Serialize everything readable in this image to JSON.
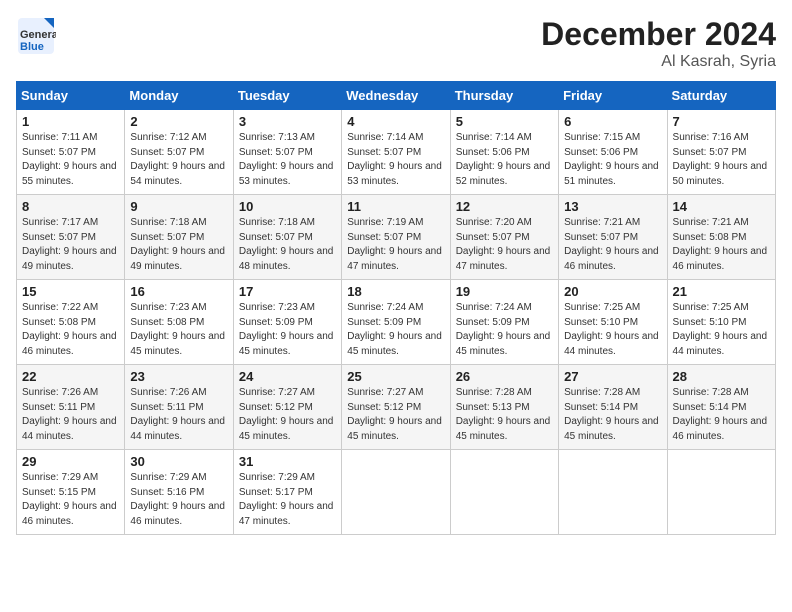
{
  "logo": {
    "general": "General",
    "blue": "Blue"
  },
  "title": "December 2024",
  "location": "Al Kasrah, Syria",
  "days_of_week": [
    "Sunday",
    "Monday",
    "Tuesday",
    "Wednesday",
    "Thursday",
    "Friday",
    "Saturday"
  ],
  "weeks": [
    [
      {
        "day": "1",
        "sunrise": "7:11 AM",
        "sunset": "5:07 PM",
        "daylight": "9 hours and 55 minutes."
      },
      {
        "day": "2",
        "sunrise": "7:12 AM",
        "sunset": "5:07 PM",
        "daylight": "9 hours and 54 minutes."
      },
      {
        "day": "3",
        "sunrise": "7:13 AM",
        "sunset": "5:07 PM",
        "daylight": "9 hours and 53 minutes."
      },
      {
        "day": "4",
        "sunrise": "7:14 AM",
        "sunset": "5:07 PM",
        "daylight": "9 hours and 53 minutes."
      },
      {
        "day": "5",
        "sunrise": "7:14 AM",
        "sunset": "5:06 PM",
        "daylight": "9 hours and 52 minutes."
      },
      {
        "day": "6",
        "sunrise": "7:15 AM",
        "sunset": "5:06 PM",
        "daylight": "9 hours and 51 minutes."
      },
      {
        "day": "7",
        "sunrise": "7:16 AM",
        "sunset": "5:07 PM",
        "daylight": "9 hours and 50 minutes."
      }
    ],
    [
      {
        "day": "8",
        "sunrise": "7:17 AM",
        "sunset": "5:07 PM",
        "daylight": "9 hours and 49 minutes."
      },
      {
        "day": "9",
        "sunrise": "7:18 AM",
        "sunset": "5:07 PM",
        "daylight": "9 hours and 49 minutes."
      },
      {
        "day": "10",
        "sunrise": "7:18 AM",
        "sunset": "5:07 PM",
        "daylight": "9 hours and 48 minutes."
      },
      {
        "day": "11",
        "sunrise": "7:19 AM",
        "sunset": "5:07 PM",
        "daylight": "9 hours and 47 minutes."
      },
      {
        "day": "12",
        "sunrise": "7:20 AM",
        "sunset": "5:07 PM",
        "daylight": "9 hours and 47 minutes."
      },
      {
        "day": "13",
        "sunrise": "7:21 AM",
        "sunset": "5:07 PM",
        "daylight": "9 hours and 46 minutes."
      },
      {
        "day": "14",
        "sunrise": "7:21 AM",
        "sunset": "5:08 PM",
        "daylight": "9 hours and 46 minutes."
      }
    ],
    [
      {
        "day": "15",
        "sunrise": "7:22 AM",
        "sunset": "5:08 PM",
        "daylight": "9 hours and 46 minutes."
      },
      {
        "day": "16",
        "sunrise": "7:23 AM",
        "sunset": "5:08 PM",
        "daylight": "9 hours and 45 minutes."
      },
      {
        "day": "17",
        "sunrise": "7:23 AM",
        "sunset": "5:09 PM",
        "daylight": "9 hours and 45 minutes."
      },
      {
        "day": "18",
        "sunrise": "7:24 AM",
        "sunset": "5:09 PM",
        "daylight": "9 hours and 45 minutes."
      },
      {
        "day": "19",
        "sunrise": "7:24 AM",
        "sunset": "5:09 PM",
        "daylight": "9 hours and 45 minutes."
      },
      {
        "day": "20",
        "sunrise": "7:25 AM",
        "sunset": "5:10 PM",
        "daylight": "9 hours and 44 minutes."
      },
      {
        "day": "21",
        "sunrise": "7:25 AM",
        "sunset": "5:10 PM",
        "daylight": "9 hours and 44 minutes."
      }
    ],
    [
      {
        "day": "22",
        "sunrise": "7:26 AM",
        "sunset": "5:11 PM",
        "daylight": "9 hours and 44 minutes."
      },
      {
        "day": "23",
        "sunrise": "7:26 AM",
        "sunset": "5:11 PM",
        "daylight": "9 hours and 44 minutes."
      },
      {
        "day": "24",
        "sunrise": "7:27 AM",
        "sunset": "5:12 PM",
        "daylight": "9 hours and 45 minutes."
      },
      {
        "day": "25",
        "sunrise": "7:27 AM",
        "sunset": "5:12 PM",
        "daylight": "9 hours and 45 minutes."
      },
      {
        "day": "26",
        "sunrise": "7:28 AM",
        "sunset": "5:13 PM",
        "daylight": "9 hours and 45 minutes."
      },
      {
        "day": "27",
        "sunrise": "7:28 AM",
        "sunset": "5:14 PM",
        "daylight": "9 hours and 45 minutes."
      },
      {
        "day": "28",
        "sunrise": "7:28 AM",
        "sunset": "5:14 PM",
        "daylight": "9 hours and 46 minutes."
      }
    ],
    [
      {
        "day": "29",
        "sunrise": "7:29 AM",
        "sunset": "5:15 PM",
        "daylight": "9 hours and 46 minutes."
      },
      {
        "day": "30",
        "sunrise": "7:29 AM",
        "sunset": "5:16 PM",
        "daylight": "9 hours and 46 minutes."
      },
      {
        "day": "31",
        "sunrise": "7:29 AM",
        "sunset": "5:17 PM",
        "daylight": "9 hours and 47 minutes."
      },
      null,
      null,
      null,
      null
    ]
  ]
}
